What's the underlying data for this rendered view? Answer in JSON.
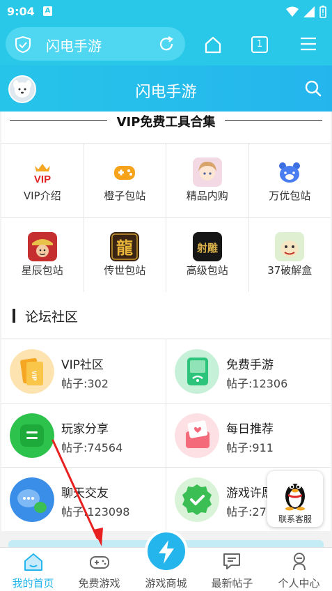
{
  "status_bar": {
    "time": "9:04",
    "badge": "A"
  },
  "browser": {
    "url_title": "闪电手游",
    "tab_count": "1"
  },
  "header": {
    "title": "闪电手游"
  },
  "vip_section": {
    "title": "VIP免费工具合集"
  },
  "tools": [
    {
      "label": "VIP介绍",
      "icon": "vip-crown-icon"
    },
    {
      "label": "橙子包站",
      "icon": "gamepad-icon"
    },
    {
      "label": "精品内购",
      "icon": "anime-girl-icon"
    },
    {
      "label": "万优包站",
      "icon": "bear-icon"
    },
    {
      "label": "星辰包站",
      "icon": "pirate-icon"
    },
    {
      "label": "传世包站",
      "icon": "dragon-icon"
    },
    {
      "label": "高级包站",
      "icon": "shediao-icon"
    },
    {
      "label": "37破解盒",
      "icon": "cartoon-icon"
    }
  ],
  "forum_section": {
    "title": "论坛社区"
  },
  "forums": [
    {
      "name": "VIP社区",
      "count": "帖子:302",
      "color": "#f5a623"
    },
    {
      "name": "免费手游",
      "count": "帖子:12306",
      "color": "#2bc47a"
    },
    {
      "name": "玩家分享",
      "count": "帖子:74564",
      "color": "#2dc24c"
    },
    {
      "name": "每日推荐",
      "count": "帖子:911",
      "color": "#f56a7a"
    },
    {
      "name": "聊天交友",
      "count": "帖子:123098",
      "color": "#3a8ee8"
    },
    {
      "name": "游戏许愿",
      "count": "帖子:27",
      "color": "#3bbf55"
    }
  ],
  "customer_service": {
    "label": "联系客服"
  },
  "nav": [
    {
      "label": "我的首页",
      "icon": "home-icon"
    },
    {
      "label": "免费游戏",
      "icon": "gamepad-nav-icon"
    },
    {
      "label": "游戏商城",
      "icon": "lightning-icon"
    },
    {
      "label": "最新帖子",
      "icon": "chat-icon"
    },
    {
      "label": "个人中心",
      "icon": "person-icon"
    }
  ],
  "colors": {
    "primary": "#24b5ec",
    "status": "#2ac8e8",
    "arrow": "#e82020"
  }
}
